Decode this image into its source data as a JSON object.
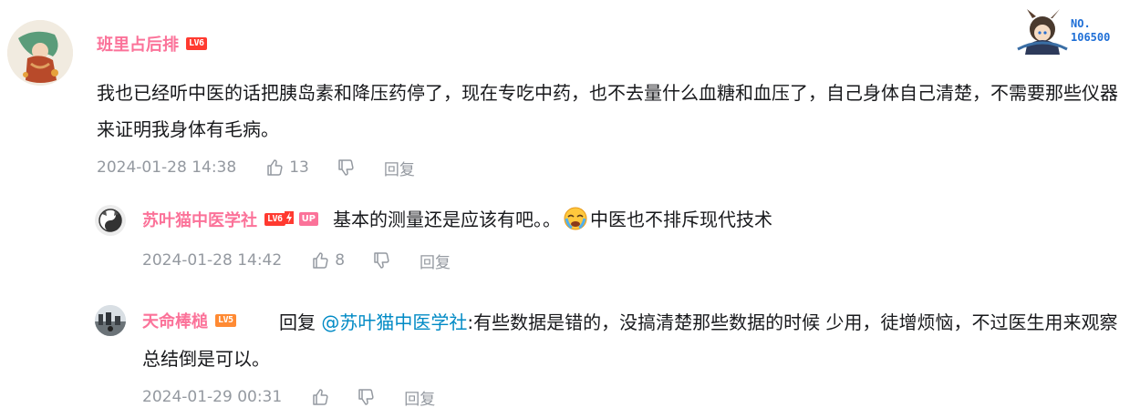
{
  "comment": {
    "username": "班里占后排",
    "level": "LV6",
    "content": "我也已经听中医的话把胰岛素和降压药停了，现在专吃中药，也不去量什么血糖和血压了，自己身体自己清楚，不需要那些仪器来证明我身体有毛病。",
    "timestamp": "2024-01-28 14:38",
    "likes": "13",
    "reply_label": "回复",
    "badge": {
      "label": "NO.",
      "number": "106500"
    }
  },
  "replies": [
    {
      "username": "苏叶猫中医学社",
      "level": "LV6",
      "up_badge": "UP",
      "content_before": "基本的测量还是应该有吧。。",
      "emoji": "crying-face-emoji",
      "content_after": "中医也不排斥现代技术",
      "timestamp": "2024-01-28 14:42",
      "likes": "8",
      "reply_label": "回复"
    },
    {
      "username": "天命棒槌",
      "level": "LV5",
      "reply_prefix": "回复",
      "mention": "@苏叶猫中医学社",
      "content": ":有些数据是错的，没搞清楚那些数据的时候  少用，徒增烦恼，不过医生用来观察总结倒是可以。",
      "timestamp": "2024-01-29 00:31",
      "likes": "",
      "reply_label": "回复"
    }
  ],
  "colors": {
    "username": "#fb7299",
    "meta": "#9499a0",
    "mention": "#008ac5",
    "text": "#18191c"
  }
}
